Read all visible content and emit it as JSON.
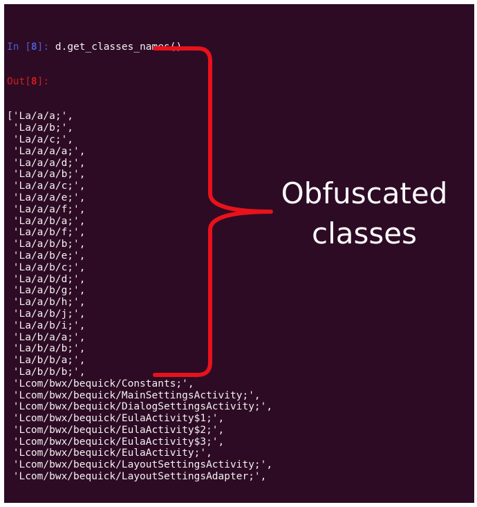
{
  "terminal": {
    "in_prompt": "In [",
    "in_number": "8",
    "in_prompt_end": "]: ",
    "command": "d.get_classes_names()",
    "out_prompt": "Out[",
    "out_number": "8",
    "out_prompt_end": "]:",
    "output_lines": [
      "['La/a/a;',",
      " 'La/a/b;',",
      " 'La/a/c;',",
      " 'La/a/a/a;',",
      " 'La/a/a/d;',",
      " 'La/a/a/b;',",
      " 'La/a/a/c;',",
      " 'La/a/a/e;',",
      " 'La/a/a/f;',",
      " 'La/a/b/a;',",
      " 'La/a/b/f;',",
      " 'La/a/b/b;',",
      " 'La/a/b/e;',",
      " 'La/a/b/c;',",
      " 'La/a/b/d;',",
      " 'La/a/b/g;',",
      " 'La/a/b/h;',",
      " 'La/a/b/j;',",
      " 'La/a/b/i;',",
      " 'La/b/a/a;',",
      " 'La/b/a/b;',",
      " 'La/b/b/a;',",
      " 'La/b/b/b;',",
      " 'Lcom/bwx/bequick/Constants;',",
      " 'Lcom/bwx/bequick/MainSettingsActivity;',",
      " 'Lcom/bwx/bequick/DialogSettingsActivity;',",
      " 'Lcom/bwx/bequick/EulaActivity$1;',",
      " 'Lcom/bwx/bequick/EulaActivity$2;',",
      " 'Lcom/bwx/bequick/EulaActivity$3;',",
      " 'Lcom/bwx/bequick/EulaActivity;',",
      " 'Lcom/bwx/bequick/LayoutSettingsActivity;',",
      " 'Lcom/bwx/bequick/LayoutSettingsAdapter;',"
    ]
  },
  "annotation": {
    "line1": "Obfuscated",
    "line2": "classes",
    "color": "#ffffff",
    "brace_color": "#e8121c"
  },
  "colors": {
    "background": "#2e0b24",
    "text": "#f2f2f2",
    "in_prompt": "#4b5ed8",
    "out_prompt": "#d11f1f"
  }
}
